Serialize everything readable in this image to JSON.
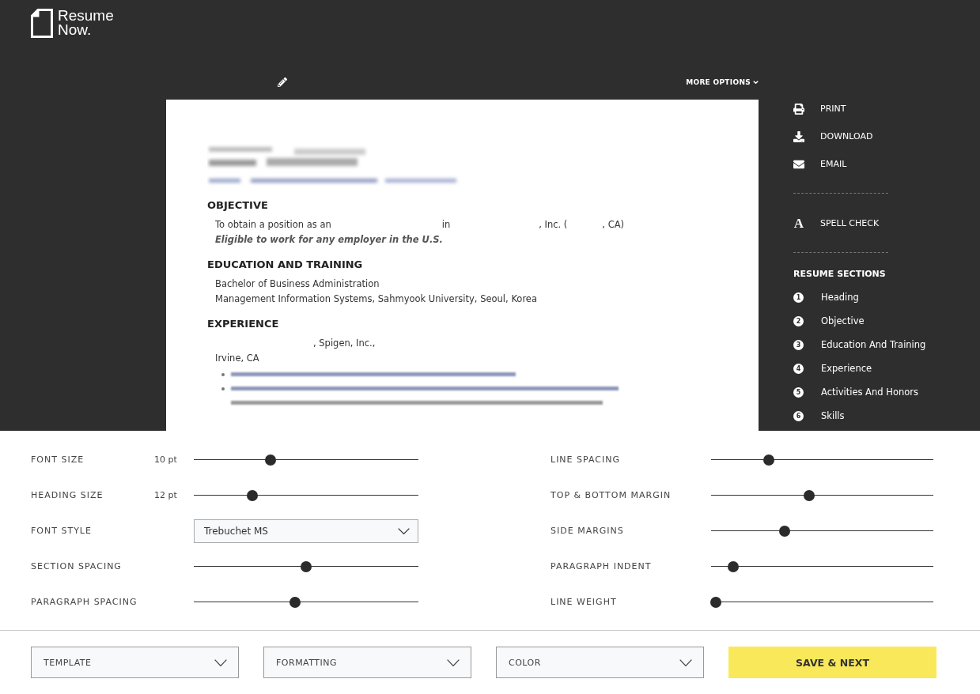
{
  "brand": {
    "lines": [
      "Resume",
      "Now."
    ]
  },
  "paper_toolbar": {
    "more_options": "MORE OPTIONS"
  },
  "resume": {
    "sections": [
      {
        "kind": "objective",
        "heading": "OBJECTIVE",
        "lines": [
          {
            "kind": "fragments",
            "parts": [
              "To obtain a position as an",
              "in",
              ", Inc. (",
              ", CA)"
            ]
          },
          {
            "kind": "italic",
            "text": "Eligible to work for any employer in the U.S."
          }
        ]
      },
      {
        "kind": "education",
        "heading": "EDUCATION AND TRAINING",
        "lines": [
          {
            "kind": "plain",
            "text": "Bachelor of Business Administration"
          },
          {
            "kind": "plain",
            "text": "Management Information Systems, Sahmyook University, Seoul, Korea"
          }
        ]
      },
      {
        "kind": "experience",
        "heading": "EXPERIENCE",
        "lines": [
          {
            "kind": "fragments",
            "parts": [
              ", Spigen, Inc.,"
            ]
          },
          {
            "kind": "plain",
            "text": "Irvine, CA"
          }
        ]
      }
    ]
  },
  "actions": [
    {
      "kind": "print",
      "label": "PRINT"
    },
    {
      "kind": "download",
      "label": "DOWNLOAD"
    },
    {
      "kind": "email",
      "label": "EMAIL"
    }
  ],
  "spell_check": {
    "glyph": "A",
    "label": "SPELL CHECK"
  },
  "resume_sections": {
    "title": "RESUME SECTIONS",
    "items": [
      {
        "number": "1",
        "label": "Heading"
      },
      {
        "number": "2",
        "label": "Objective"
      },
      {
        "number": "3",
        "label": "Education And Training"
      },
      {
        "number": "4",
        "label": "Experience"
      },
      {
        "number": "5",
        "label": "Activities And Honors"
      },
      {
        "number": "6",
        "label": "Skills"
      }
    ]
  },
  "settings": {
    "left": [
      {
        "kind": "slider",
        "label": "FONT SIZE",
        "value": "10 pt",
        "level": 0.34
      },
      {
        "kind": "slider",
        "label": "HEADING SIZE",
        "value": "12 pt",
        "level": 0.26
      },
      {
        "kind": "select",
        "label": "FONT STYLE",
        "value": "Trebuchet MS"
      },
      {
        "kind": "slider",
        "label": "SECTION SPACING",
        "level": 0.5
      },
      {
        "kind": "slider",
        "label": "PARAGRAPH SPACING",
        "level": 0.45
      }
    ],
    "right": [
      {
        "kind": "slider",
        "label": "LINE SPACING",
        "level": 0.26
      },
      {
        "kind": "slider",
        "label": "TOP & BOTTOM MARGIN",
        "level": 0.44
      },
      {
        "kind": "slider",
        "label": "SIDE MARGINS",
        "level": 0.33
      },
      {
        "kind": "slider",
        "label": "PARAGRAPH INDENT",
        "level": 0.1
      },
      {
        "kind": "slider",
        "label": "LINE WEIGHT",
        "level": 0.02
      }
    ]
  },
  "bottom_bar": {
    "dropdowns": [
      "TEMPLATE",
      "FORMATTING",
      "COLOR"
    ],
    "primary_button": "SAVE & NEXT"
  }
}
